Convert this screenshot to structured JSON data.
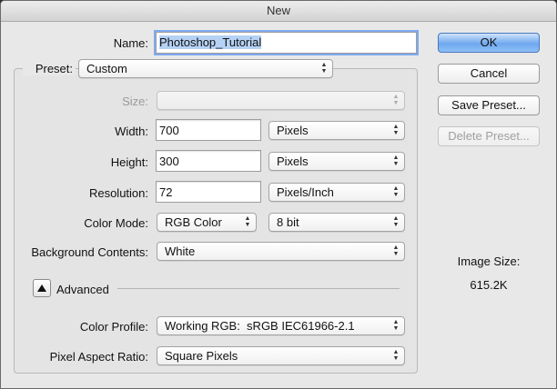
{
  "window": {
    "title": "New"
  },
  "name": {
    "label": "Name:",
    "value": "Photoshop_Tutorial"
  },
  "preset": {
    "label": "Preset:",
    "value": "Custom"
  },
  "size": {
    "label": "Size:",
    "value": ""
  },
  "width": {
    "label": "Width:",
    "value": "700",
    "unit": "Pixels"
  },
  "height": {
    "label": "Height:",
    "value": "300",
    "unit": "Pixels"
  },
  "resolution": {
    "label": "Resolution:",
    "value": "72",
    "unit": "Pixels/Inch"
  },
  "color_mode": {
    "label": "Color Mode:",
    "value": "RGB Color",
    "depth": "8 bit"
  },
  "background": {
    "label": "Background Contents:",
    "value": "White"
  },
  "advanced": {
    "label": "Advanced"
  },
  "color_profile": {
    "label": "Color Profile:",
    "value": "Working RGB:  sRGB IEC61966-2.1"
  },
  "pixel_aspect": {
    "label": "Pixel Aspect Ratio:",
    "value": "Square Pixels"
  },
  "buttons": {
    "ok": "OK",
    "cancel": "Cancel",
    "save_preset": "Save Preset...",
    "delete_preset": "Delete Preset..."
  },
  "image_size": {
    "label": "Image Size:",
    "value": "615.2K"
  },
  "colors": {
    "default_button": "#6fa8ef",
    "focus_ring": "#7eaaf0",
    "selection": "#b5d2f5"
  }
}
